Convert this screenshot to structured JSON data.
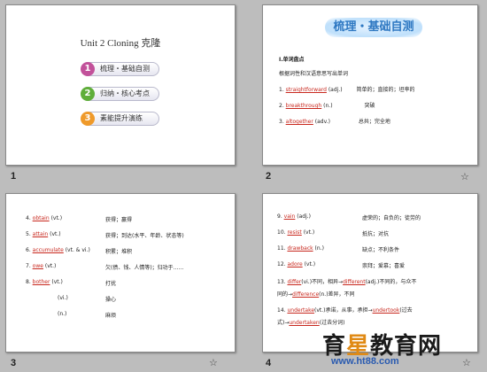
{
  "slides": [
    {
      "number": "1",
      "title": "Unit 2    Cloning  克隆",
      "buttons": [
        {
          "num": "1",
          "label": "梳理・基础自测",
          "color": "#c2519a"
        },
        {
          "num": "2",
          "label": "归纳・核心考点",
          "color": "#5fae3a"
        },
        {
          "num": "3",
          "label": "素能提升演练",
          "color": "#ef9a2a"
        }
      ]
    },
    {
      "number": "2",
      "star": "☆",
      "header": "梳理・基础自测",
      "lines": [
        "Ⅰ.单词盘点",
        "根据词性和汉语意思写出单词",
        "1.",
        "straightforward",
        "(adj.)",
        "简单的；直接的；坦率的",
        "2.",
        "breakthrough",
        "(n.)",
        "突破",
        "3.",
        "altogether",
        "(adv.)",
        "总共；完全地"
      ]
    },
    {
      "number": "3",
      "star": "☆",
      "rows": [
        {
          "n": "4.",
          "w": "obtain",
          "p": "(vt.)",
          "m": "获得；赢得"
        },
        {
          "n": "5.",
          "w": "attain",
          "p": "(vt.)",
          "m": "获得；到达(水平、年龄、状态等)"
        },
        {
          "n": "6.",
          "w": "accumulate",
          "p": "(vt. & vi.)",
          "m": "积累；堆积"
        },
        {
          "n": "7.",
          "w": "owe",
          "p": "(vt.)",
          "m": "欠(债、钱、人情等)；归功于……"
        },
        {
          "n": "8.",
          "w": "bother",
          "p": "(vt.)",
          "m": "打扰"
        },
        {
          "n": "",
          "w": "",
          "p": "(vi.)",
          "m": "操心"
        },
        {
          "n": "",
          "w": "",
          "p": "(n.)",
          "m": "麻烦"
        }
      ]
    },
    {
      "number": "4",
      "star": "☆",
      "rows": [
        {
          "n": "9.",
          "w": "vain",
          "p": "(adj.)",
          "m": "虚荣的；自负的；徒劳的"
        },
        {
          "n": "10.",
          "w": "resist",
          "p": "(vt.)",
          "m": "抵抗；对抗"
        },
        {
          "n": "11.",
          "w": "drawback",
          "p": "(n.)",
          "m": "缺点；不利条件"
        },
        {
          "n": "12.",
          "w": "adore",
          "p": "(vt.)",
          "m": "崇拜；爱慕；喜爱"
        }
      ],
      "line13a": "13.",
      "line13w": "differ",
      "line13b": "(vi.)不同，相异→",
      "line13w2": "different",
      "line13c": "(adj.)不同的，与众不",
      "line13d": "同的→",
      "line13w3": "difference",
      "line13e": "(n.)差异，不同",
      "line14a": "14.",
      "line14w": "undertake",
      "line14b": "(vt.)承诺，从事，承担→",
      "line14w2": "undertook",
      "line14c": "(过去",
      "line14d": "式)→",
      "line14w3": "undertaken",
      "line14e": "(过去分词)"
    }
  ],
  "watermark": {
    "text_a": "育",
    "text_b": "星",
    "text_c": "教育网",
    "url": "www.ht88.com"
  }
}
